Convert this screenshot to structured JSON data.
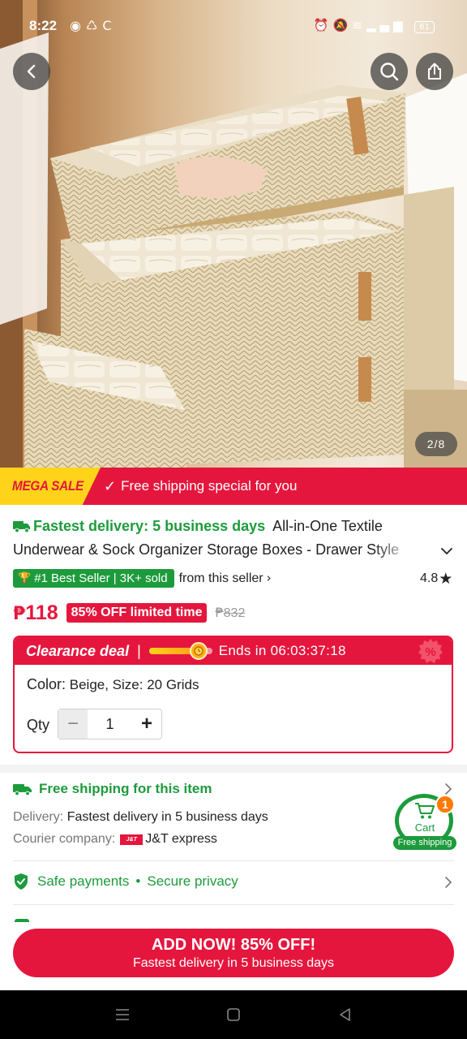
{
  "status_bar": {
    "time": "8:22",
    "notif_icons": [
      "messenger-icon",
      "recycle-icon",
      "sync-icon"
    ],
    "right_icons": [
      "alarm-icon",
      "mute-icon",
      "wifi-icon",
      "signal-icon"
    ],
    "battery": "61"
  },
  "gallery": {
    "counter": "2/8",
    "alt": "storage-boxes-photo"
  },
  "promo": {
    "mega_sale": "MEGA SALE",
    "free_shipping": "Free shipping special for you"
  },
  "product": {
    "fastest_delivery": "Fastest delivery: 5 business days",
    "title_part1": "All-in-One Textile",
    "title_part2": "Underwear & Sock Organizer Storage Boxes - Drawer Style"
  },
  "best_seller": {
    "badge": "#1 Best Seller | 3K+ sold",
    "from_seller": "from this seller"
  },
  "rating": {
    "value": "4.8"
  },
  "price": {
    "currency": "₱",
    "current": "118",
    "discount": "85% OFF limited time",
    "original": "832"
  },
  "clearance": {
    "title": "Clearance deal",
    "separator": "|",
    "progress": 0.78,
    "ends_in_label": "Ends in",
    "countdown": "06:03:37:18",
    "variant_label": "Color:",
    "variant_value": "Beige, Size: 20 Grids",
    "size_label": "Size:",
    "qty_label": "Qty",
    "qty_value": "1",
    "minus": "−",
    "plus": "+"
  },
  "shipping": {
    "title": "Free shipping for this item",
    "delivery_label": "Delivery:",
    "delivery_value": "Fastest delivery in 5 business days",
    "courier_label": "Courier company:",
    "courier_logo": "J&T EXPRESS",
    "courier_value": "J&T express"
  },
  "safety": {
    "safe_payments": "Safe payments",
    "dot": "•",
    "secure_privacy": "Secure privacy"
  },
  "cart": {
    "label": "Cart",
    "count": "1",
    "free_shipping": "Free shipping"
  },
  "cta": {
    "line1": "ADD NOW! 85% OFF!",
    "line2": "Fastest delivery in 5 business days"
  },
  "colors": {
    "brand_red": "#e5163d",
    "green": "#1d9b3c",
    "mega_yellow": "#ffd319"
  }
}
